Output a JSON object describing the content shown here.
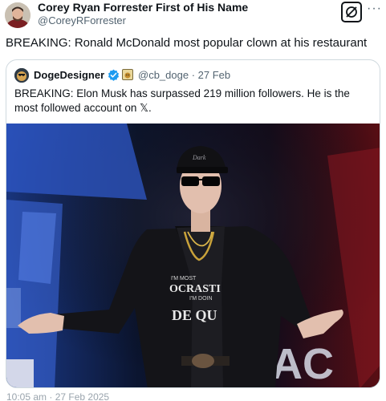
{
  "post": {
    "author_name": "Corey Ryan Forrester First of His Name",
    "author_handle": "@CoreyRForrester",
    "more_icon": "more-dots-icon",
    "grok_icon": "grok-icon",
    "text": "BREAKING: Ronald McDonald most popular clown at his restaurant",
    "footer_text": "10:05 am · 27 Feb 2025"
  },
  "quote": {
    "author_name": "DogeDesigner",
    "author_handle": "@cb_doge",
    "separator": "·",
    "date": "27 Feb",
    "verified_icon": "verified-badge-icon",
    "affiliate_icon": "affiliate-badge-icon",
    "text": "BREAKING: Elon Musk has surpassed 219 million followers. He is the most followed account on 𝕏.",
    "image_alt": "photo-of-man-in-black-jacket-sunglasses-cap-on-stage"
  },
  "image_text": {
    "cap": "Dark",
    "shirt_line1": "I'M MOST",
    "shirt_line2": "OCRASTI",
    "shirt_line3": "I'M DOIN",
    "shirt_line4": "DE QU",
    "backdrop": "AC"
  },
  "colors": {
    "text_primary": "#0f1419",
    "text_secondary": "#536471",
    "border": "#cfd9de",
    "verified_blue": "#1d9bf0"
  }
}
